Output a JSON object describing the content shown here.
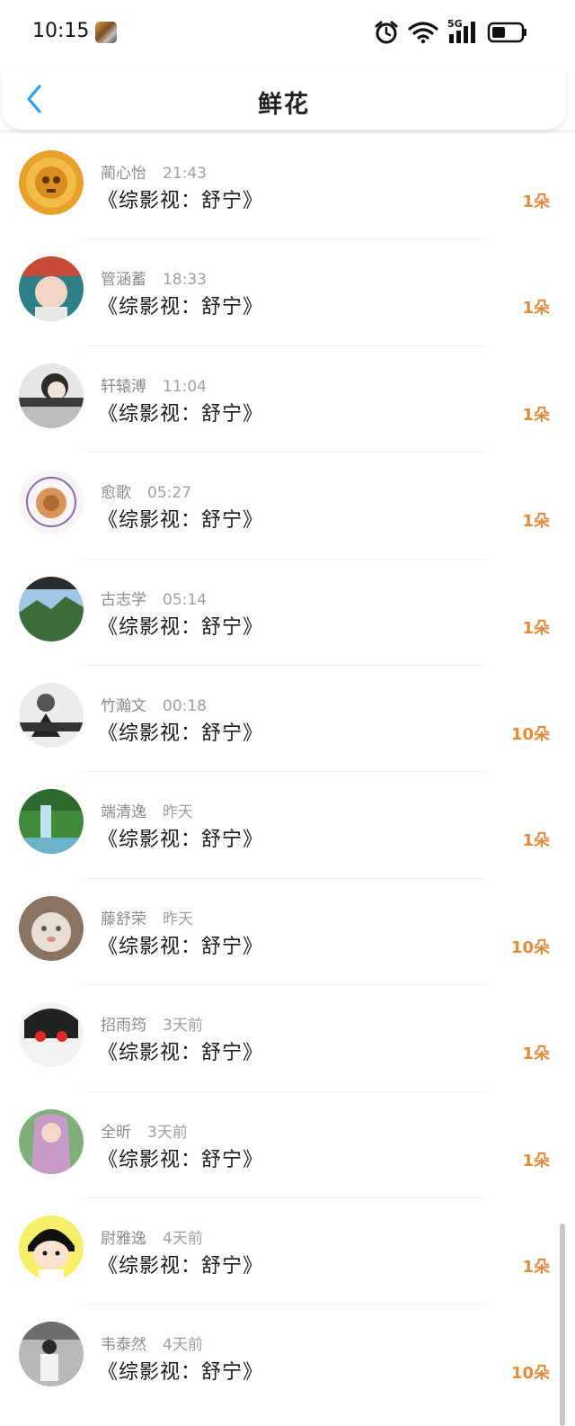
{
  "status_bar": {
    "time": "10:15",
    "network": "5G",
    "icons": [
      "app-icon",
      "alarm-icon",
      "wifi-icon",
      "signal-icon",
      "battery-icon"
    ]
  },
  "header": {
    "title": "鲜花",
    "back_icon": "chevron-left-icon"
  },
  "colors": {
    "accent_count": "#e48a3c",
    "back_arrow": "#2a9df4"
  },
  "items": [
    {
      "name": "蔺心怡",
      "time": "21:43",
      "book": "《综影视：舒宁》",
      "count": "1朵"
    },
    {
      "name": "管涵蓄",
      "time": "18:33",
      "book": "《综影视：舒宁》",
      "count": "1朵"
    },
    {
      "name": "轩辕溥",
      "time": "11:04",
      "book": "《综影视：舒宁》",
      "count": "1朵"
    },
    {
      "name": "愈歌",
      "time": "05:27",
      "book": "《综影视：舒宁》",
      "count": "1朵"
    },
    {
      "name": "古志学",
      "time": "05:14",
      "book": "《综影视：舒宁》",
      "count": "1朵"
    },
    {
      "name": "竹瀚文",
      "time": "00:18",
      "book": "《综影视：舒宁》",
      "count": "10朵"
    },
    {
      "name": "端清逸",
      "time": "昨天",
      "book": "《综影视：舒宁》",
      "count": "1朵"
    },
    {
      "name": "藤舒荣",
      "time": "昨天",
      "book": "《综影视：舒宁》",
      "count": "10朵"
    },
    {
      "name": "招雨筠",
      "time": "3天前",
      "book": "《综影视：舒宁》",
      "count": "1朵"
    },
    {
      "name": "全昕",
      "time": "3天前",
      "book": "《综影视：舒宁》",
      "count": "1朵"
    },
    {
      "name": "尉雅逸",
      "time": "4天前",
      "book": "《综影视：舒宁》",
      "count": "1朵"
    },
    {
      "name": "韦泰然",
      "time": "4天前",
      "book": "《综影视：舒宁》",
      "count": "10朵"
    }
  ]
}
